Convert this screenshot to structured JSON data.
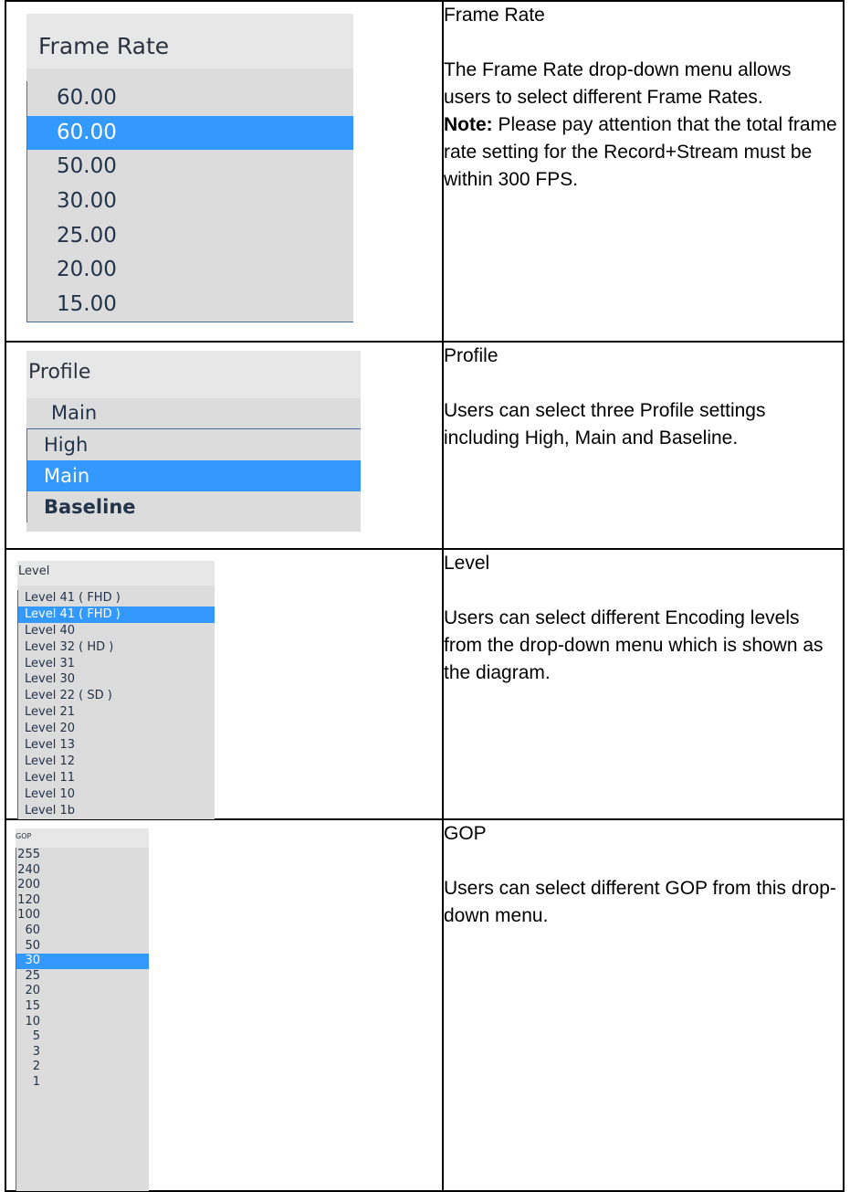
{
  "frame_rate": {
    "panel_title": "Frame Rate",
    "current_value": "60.00",
    "options": [
      "60.00",
      "50.00",
      "30.00",
      "25.00",
      "20.00",
      "15.00"
    ],
    "selected_option": "60.00",
    "desc_title": "Frame Rate",
    "desc_text": "The Frame Rate drop-down menu allows users to select different Frame Rates.",
    "note_label": "Note:",
    "note_text": " Please pay attention that the total frame rate setting for the Record+Stream must be within 300 FPS."
  },
  "profile": {
    "panel_title": "Profile",
    "current_value": "Main",
    "options": [
      "High",
      "Main",
      "Baseline"
    ],
    "selected_option": "Main",
    "desc_title": "Profile",
    "desc_text": "Users can select three Profile settings including High, Main and Baseline."
  },
  "level": {
    "panel_title": "Level",
    "current_value": "Level 41 ( FHD )",
    "options": [
      "Level 41 ( FHD )",
      "Level 40",
      "Level 32 ( HD )",
      "Level 31",
      "Level 30",
      "Level 22 ( SD )",
      "Level 21",
      "Level 20",
      "Level 13",
      "Level 12",
      "Level 11",
      "Level 10",
      "Level 1b"
    ],
    "selected_option": "Level 41 ( FHD )",
    "desc_title": "Level",
    "desc_text": "Users can select different Encoding levels from the drop-down menu which is shown as the diagram."
  },
  "gop": {
    "panel_title": "GOP",
    "options": [
      "255",
      "240",
      "200",
      "120",
      "100",
      "60",
      "50",
      "30",
      "25",
      "20",
      "15",
      "10",
      "5",
      "3",
      "2",
      "1"
    ],
    "selected_option": "30",
    "desc_title": "GOP",
    "desc_text": "Users can select different GOP from this drop-down menu."
  },
  "colors": {
    "selection": "#3399ff",
    "dropdown_background": "#dcdcdc",
    "dropdown_border": "#4a6c9c",
    "option_text": "#22334a"
  }
}
